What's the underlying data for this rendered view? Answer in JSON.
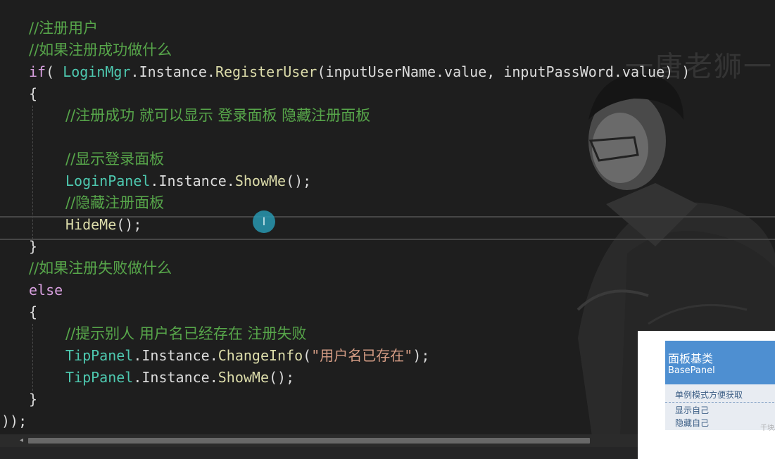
{
  "watermark": "一唐老狮一",
  "code_lines": [
    [
      {
        "t": "//注册用户",
        "c": "cm"
      }
    ],
    [
      {
        "t": "//如果注册成功做什么",
        "c": "cm"
      }
    ],
    [
      {
        "t": "if",
        "c": "kw"
      },
      {
        "t": "( ",
        "c": "pn"
      },
      {
        "t": "LoginMgr",
        "c": "ty"
      },
      {
        "t": ".",
        "c": "pn"
      },
      {
        "t": "Instance",
        "c": "id"
      },
      {
        "t": ".",
        "c": "pn"
      },
      {
        "t": "RegisterUser",
        "c": "mt"
      },
      {
        "t": "(inputUserName.value, inputPassWord.value) )",
        "c": "id"
      }
    ],
    [
      {
        "t": "{",
        "c": "pn"
      }
    ],
    [
      {
        "t": "//注册成功 就可以显示 登录面板 隐藏注册面板",
        "c": "cm"
      }
    ],
    [],
    [
      {
        "t": "//显示登录面板",
        "c": "cm"
      }
    ],
    [
      {
        "t": "LoginPanel",
        "c": "ty"
      },
      {
        "t": ".",
        "c": "pn"
      },
      {
        "t": "Instance",
        "c": "id"
      },
      {
        "t": ".",
        "c": "pn"
      },
      {
        "t": "ShowMe",
        "c": "mt"
      },
      {
        "t": "();",
        "c": "pn"
      }
    ],
    [
      {
        "t": "//隐藏注册面板",
        "c": "cm"
      }
    ],
    [
      {
        "t": "HideMe",
        "c": "mt"
      },
      {
        "t": "();",
        "c": "pn"
      }
    ],
    [
      {
        "t": "}",
        "c": "pn"
      }
    ],
    [
      {
        "t": "//如果注册失败做什么",
        "c": "cm"
      }
    ],
    [
      {
        "t": "else",
        "c": "kw"
      }
    ],
    [
      {
        "t": "{",
        "c": "pn"
      }
    ],
    [
      {
        "t": "//提示别人 用户名已经存在 注册失败",
        "c": "cm"
      }
    ],
    [
      {
        "t": "TipPanel",
        "c": "ty"
      },
      {
        "t": ".",
        "c": "pn"
      },
      {
        "t": "Instance",
        "c": "id"
      },
      {
        "t": ".",
        "c": "pn"
      },
      {
        "t": "ChangeInfo",
        "c": "mt"
      },
      {
        "t": "(",
        "c": "pn"
      },
      {
        "t": "\"用户名已存在\"",
        "c": "st"
      },
      {
        "t": ");",
        "c": "pn"
      }
    ],
    [
      {
        "t": "TipPanel",
        "c": "ty"
      },
      {
        "t": ".",
        "c": "pn"
      },
      {
        "t": "Instance",
        "c": "id"
      },
      {
        "t": ".",
        "c": "pn"
      },
      {
        "t": "ShowMe",
        "c": "mt"
      },
      {
        "t": "();",
        "c": "pn"
      }
    ],
    [
      {
        "t": "}",
        "c": "pn"
      }
    ],
    [
      {
        "t": "));",
        "c": "pn"
      }
    ]
  ],
  "caret_icon": "I",
  "inset": {
    "title": "面板基类",
    "subtitle": "BasePanel",
    "items": [
      "单例模式方便获取",
      "显示自己",
      "隐藏自己"
    ],
    "watermark": "千块AINI w"
  },
  "colors": {
    "comment": "#57a64a",
    "keyword": "#d8a0df",
    "type": "#4ec9b0",
    "method": "#dcdcaa",
    "string": "#d69d85",
    "text": "#dcdcdc",
    "background": "#1e1e1e",
    "inset_header": "#4e8fd1"
  }
}
